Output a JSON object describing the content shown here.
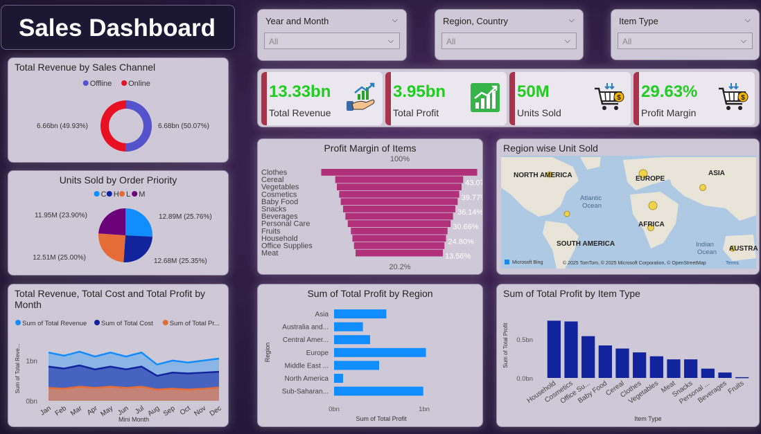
{
  "title": "Sales Dashboard",
  "slicers": [
    {
      "label": "Year and Month",
      "value": "All"
    },
    {
      "label": "Region, Country",
      "value": "All"
    },
    {
      "label": "Item Type",
      "value": "All"
    }
  ],
  "kpis": [
    {
      "value": "13.33bn",
      "label": "Total Revenue",
      "icon": "money-growth-icon"
    },
    {
      "value": "3.95bn",
      "label": "Total Profit",
      "icon": "bar-chart-growth-icon"
    },
    {
      "value": "50M",
      "label": "Units Sold",
      "icon": "shopping-cart-icon"
    },
    {
      "value": "29.63%",
      "label": "Profit Margin",
      "icon": "shopping-cart-icon"
    }
  ],
  "colors": {
    "blue": "#118dff",
    "navy": "#12239e",
    "orange": "#e66c37",
    "purple": "#6b007b",
    "online_red": "#e81123",
    "offline_blue": "#5552cc",
    "funnel": "#b0307a",
    "bar_blue": "#118dff",
    "bar_navy": "#12239e"
  },
  "chart_data": [
    {
      "id": "revenue-by-channel",
      "type": "pie",
      "subtype": "donut",
      "title": "Total Revenue by Sales Channel",
      "legend": [
        "Offline",
        "Online"
      ],
      "legend_position": "top",
      "slices": [
        {
          "name": "Offline",
          "value": 6.68,
          "label": "6.68bn (50.07%)"
        },
        {
          "name": "Online",
          "value": 6.66,
          "label": "6.66bn (49.93%)"
        }
      ]
    },
    {
      "id": "units-by-priority",
      "type": "pie",
      "title": "Units Sold by Order Priority",
      "legend": [
        "C",
        "H",
        "L",
        "M"
      ],
      "legend_position": "top",
      "slices": [
        {
          "name": "C",
          "value": 12.89,
          "label": "12.89M (25.76%)"
        },
        {
          "name": "H",
          "value": 12.68,
          "label": "12.68M (25.35%)"
        },
        {
          "name": "L",
          "value": 12.51,
          "label": "12.51M (25.00%)"
        },
        {
          "name": "M",
          "value": 11.95,
          "label": "11.95M (23.90%)"
        }
      ]
    },
    {
      "id": "monthly-revenue-cost-profit",
      "type": "area",
      "title": "Total Revenue, Total Cost and Total Profit by Month",
      "legend": [
        "Sum of Total Revenue",
        "Sum of Total Cost",
        "Sum of Total Pr..."
      ],
      "legend_position": "top",
      "xlabel": "Mini Month",
      "ylabel": "Sum of Total Reve...",
      "y_ticks": [
        "0bn",
        "1bn"
      ],
      "ylim": [
        0,
        1.6
      ],
      "x": [
        "Jan",
        "Feb",
        "Mar",
        "Apr",
        "May",
        "Jun",
        "Jul",
        "Aug",
        "Sep",
        "Oct",
        "Nov",
        "Dec"
      ],
      "series": [
        {
          "name": "Sum of Total Revenue",
          "values": [
            1.2,
            1.12,
            1.22,
            1.1,
            1.2,
            1.1,
            1.2,
            0.9,
            1.0,
            0.95,
            1.0,
            1.05
          ]
        },
        {
          "name": "Sum of Total Cost",
          "values": [
            0.85,
            0.8,
            0.88,
            0.78,
            0.85,
            0.78,
            0.85,
            0.62,
            0.7,
            0.68,
            0.7,
            0.72
          ]
        },
        {
          "name": "Sum of Total Pr...",
          "values": [
            0.32,
            0.3,
            0.35,
            0.32,
            0.35,
            0.32,
            0.35,
            0.28,
            0.3,
            0.28,
            0.3,
            0.33
          ]
        }
      ]
    },
    {
      "id": "profit-margin-items",
      "type": "bar",
      "subtype": "funnel",
      "title": "Profit Margin of Items",
      "top_label": "100%",
      "bottom_label": "20.2%",
      "categories": [
        "Clothes",
        "Cereal",
        "Vegetables",
        "Cosmetics",
        "Baby Food",
        "Snacks",
        "Beverages",
        "Personal Care",
        "Fruits",
        "Household",
        "Office Supplies",
        "Meat"
      ],
      "values": [
        100,
        82,
        80,
        77,
        75,
        72,
        69,
        66,
        62,
        60,
        58,
        56
      ],
      "labels": [
        "",
        "43.07%",
        "",
        "39.77%",
        "",
        "36.14%",
        "",
        "30.66%",
        "",
        "24.80%",
        "",
        "13.56%"
      ]
    },
    {
      "id": "region-unit-sold-map",
      "type": "map",
      "title": "Region wise Unit Sold",
      "places": [
        "NORTH AMERICA",
        "EUROPE",
        "ASIA",
        "AFRICA",
        "SOUTH AMERICA",
        "AUSTRA",
        "Atlantic Ocean",
        "Indian Ocean"
      ],
      "copyright": "© 2025 TomTom, © 2025 Microsoft Corporation, © OpenStreetMap",
      "terms": "Terms",
      "brand": "Microsoft Bing"
    },
    {
      "id": "profit-by-region",
      "type": "bar",
      "orientation": "horizontal",
      "title": "Sum of Total Profit by Region",
      "xlabel": "Sum of Total Profit",
      "ylabel": "Region",
      "x_ticks": [
        "0bn",
        "1bn"
      ],
      "xlim": [
        0,
        1.0
      ],
      "categories": [
        "Asia",
        "Australia and...",
        "Central Amer...",
        "Europe",
        "Middle East ...",
        "North America",
        "Sub-Saharan..."
      ],
      "values": [
        0.58,
        0.32,
        0.4,
        1.02,
        0.5,
        0.1,
        0.99
      ]
    },
    {
      "id": "profit-by-item-type",
      "type": "bar",
      "title": "Sum of Total Profit by Item Type",
      "xlabel": "Item Type",
      "ylabel": "Sum of Total Profit",
      "y_ticks": [
        "0.0bn",
        "0.5bn"
      ],
      "ylim": [
        0,
        0.85
      ],
      "categories": [
        "Household",
        "Cosmetics",
        "Office Su...",
        "Baby Food",
        "Cereal",
        "Clothes",
        "Vegetables",
        "Meat",
        "Snacks",
        "Personal ...",
        "Beverages",
        "Fruits"
      ],
      "values": [
        0.74,
        0.73,
        0.54,
        0.42,
        0.38,
        0.33,
        0.28,
        0.24,
        0.24,
        0.12,
        0.07,
        0.01
      ]
    }
  ]
}
